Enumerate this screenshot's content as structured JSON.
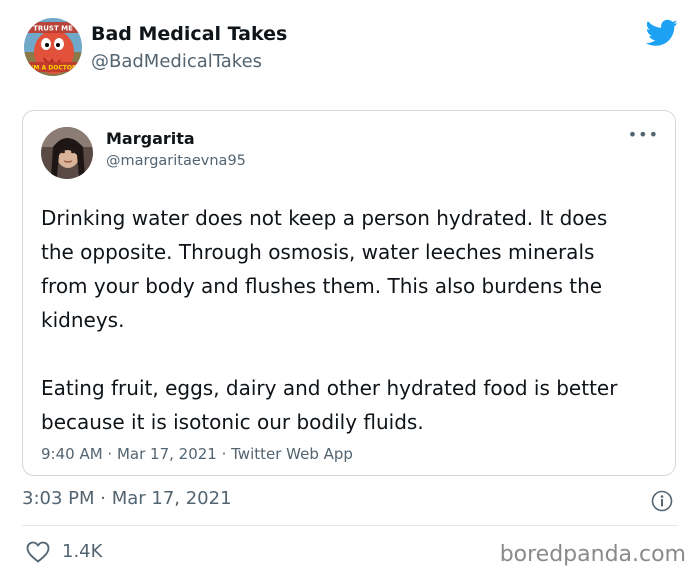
{
  "author": {
    "display_name": "Bad Medical Takes",
    "handle": "@BadMedicalTakes",
    "avatar_icon": "zoidberg-doctor-avatar",
    "avatar_text_top": "TRUST ME",
    "avatar_text_bottom": "I'M A DOCTOR"
  },
  "quoted_tweet": {
    "display_name": "Margarita",
    "handle": "@margaritaevna95",
    "more_label": "•••",
    "paragraphs": [
      "Drinking water does not keep a person hydrated. It does the opposite. Through osmosis, water leeches minerals from your body and flushes them. This also burdens the kidneys.",
      "Eating fruit, eggs, dairy and other hydrated food is better because it is isotonic our bodily fluids."
    ],
    "meta": "9:40 AM · Mar 17, 2021 · Twitter Web App"
  },
  "footer": {
    "timestamp": "3:03 PM · Mar 17, 2021",
    "like_count": "1.4K"
  },
  "watermark": "boredpanda.com",
  "colors": {
    "twitter_blue": "#1da1f2",
    "secondary_text": "#536471",
    "border": "#cfd9de"
  }
}
